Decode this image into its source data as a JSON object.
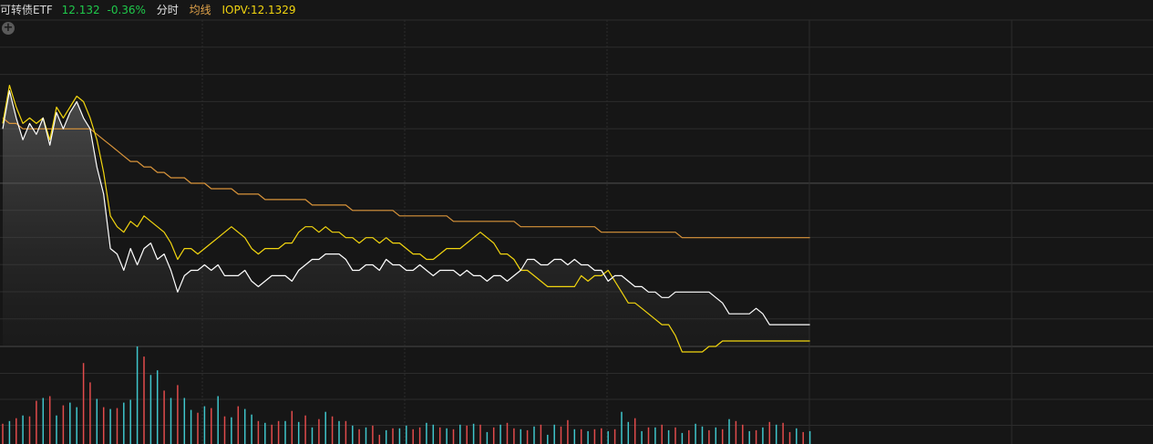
{
  "header": {
    "name": "可转债ETF",
    "price": "12.132",
    "change": "-0.36%",
    "period": "分时",
    "avg_label": "均线",
    "iopv": "IOPV:12.1329"
  },
  "colors": {
    "price_line": "#ffffff",
    "iopv_line": "#f2d50f",
    "avg_line": "#d9943a",
    "vol_up": "#e24b4b",
    "vol_down": "#3fc6cc",
    "grid": "#2c2c2c"
  },
  "chart_data": {
    "type": "line",
    "y_range": [
      12.12,
      12.18
    ],
    "series": [
      {
        "key": "price",
        "values": [
          12.16,
          12.167,
          12.162,
          12.158,
          12.161,
          12.159,
          12.162,
          12.157,
          12.163,
          12.16,
          12.163,
          12.165,
          12.162,
          12.16,
          12.153,
          12.148,
          12.138,
          12.137,
          12.134,
          12.138,
          12.135,
          12.138,
          12.139,
          12.136,
          12.137,
          12.134,
          12.13,
          12.133,
          12.134,
          12.134,
          12.135,
          12.134,
          12.135,
          12.133,
          12.133,
          12.133,
          12.134,
          12.132,
          12.131,
          12.132,
          12.133,
          12.133,
          12.133,
          12.132,
          12.134,
          12.135,
          12.136,
          12.136,
          12.137,
          12.137,
          12.137,
          12.136,
          12.134,
          12.134,
          12.135,
          12.135,
          12.134,
          12.136,
          12.135,
          12.135,
          12.134,
          12.134,
          12.135,
          12.134,
          12.133,
          12.134,
          12.134,
          12.134,
          12.133,
          12.134,
          12.133,
          12.133,
          12.132,
          12.133,
          12.133,
          12.132,
          12.133,
          12.134,
          12.136,
          12.136,
          12.135,
          12.135,
          12.136,
          12.136,
          12.135,
          12.136,
          12.135,
          12.135,
          12.134,
          12.134,
          12.132,
          12.133,
          12.133,
          12.132,
          12.131,
          12.131,
          12.13,
          12.13,
          12.129,
          12.129,
          12.13,
          12.13,
          12.13,
          12.13,
          12.13,
          12.13,
          12.129,
          12.128,
          12.126,
          12.126,
          12.126,
          12.126,
          12.127,
          12.126,
          12.124,
          12.124,
          12.124,
          12.124,
          12.124,
          12.124,
          12.124
        ]
      },
      {
        "key": "iopv",
        "values": [
          12.161,
          12.168,
          12.164,
          12.161,
          12.162,
          12.161,
          12.162,
          12.158,
          12.164,
          12.162,
          12.164,
          12.166,
          12.165,
          12.162,
          12.158,
          12.152,
          12.144,
          12.142,
          12.141,
          12.143,
          12.142,
          12.144,
          12.143,
          12.142,
          12.141,
          12.139,
          12.136,
          12.138,
          12.138,
          12.137,
          12.138,
          12.139,
          12.14,
          12.141,
          12.142,
          12.141,
          12.14,
          12.138,
          12.137,
          12.138,
          12.138,
          12.138,
          12.139,
          12.139,
          12.141,
          12.142,
          12.142,
          12.141,
          12.142,
          12.141,
          12.141,
          12.14,
          12.14,
          12.139,
          12.14,
          12.14,
          12.139,
          12.14,
          12.139,
          12.139,
          12.138,
          12.137,
          12.137,
          12.136,
          12.136,
          12.137,
          12.138,
          12.138,
          12.138,
          12.139,
          12.14,
          12.141,
          12.14,
          12.139,
          12.137,
          12.137,
          12.136,
          12.134,
          12.134,
          12.133,
          12.132,
          12.131,
          12.131,
          12.131,
          12.131,
          12.131,
          12.133,
          12.132,
          12.133,
          12.133,
          12.134,
          12.132,
          12.13,
          12.128,
          12.128,
          12.127,
          12.126,
          12.125,
          12.124,
          12.124,
          12.122,
          12.119,
          12.119,
          12.119,
          12.119,
          12.12,
          12.12,
          12.121,
          12.121,
          12.121,
          12.121,
          12.121,
          12.121,
          12.121,
          12.121,
          12.121,
          12.121,
          12.121,
          12.121,
          12.121,
          12.121
        ]
      },
      {
        "key": "avg",
        "values": [
          12.162,
          12.161,
          12.161,
          12.16,
          12.16,
          12.16,
          12.16,
          12.16,
          12.16,
          12.16,
          12.16,
          12.16,
          12.16,
          12.16,
          12.159,
          12.158,
          12.157,
          12.156,
          12.155,
          12.154,
          12.154,
          12.153,
          12.153,
          12.152,
          12.152,
          12.151,
          12.151,
          12.151,
          12.15,
          12.15,
          12.15,
          12.149,
          12.149,
          12.149,
          12.149,
          12.148,
          12.148,
          12.148,
          12.148,
          12.147,
          12.147,
          12.147,
          12.147,
          12.147,
          12.147,
          12.147,
          12.146,
          12.146,
          12.146,
          12.146,
          12.146,
          12.146,
          12.145,
          12.145,
          12.145,
          12.145,
          12.145,
          12.145,
          12.145,
          12.144,
          12.144,
          12.144,
          12.144,
          12.144,
          12.144,
          12.144,
          12.144,
          12.143,
          12.143,
          12.143,
          12.143,
          12.143,
          12.143,
          12.143,
          12.143,
          12.143,
          12.143,
          12.142,
          12.142,
          12.142,
          12.142,
          12.142,
          12.142,
          12.142,
          12.142,
          12.142,
          12.142,
          12.142,
          12.142,
          12.141,
          12.141,
          12.141,
          12.141,
          12.141,
          12.141,
          12.141,
          12.141,
          12.141,
          12.141,
          12.141,
          12.141,
          12.14,
          12.14,
          12.14,
          12.14,
          12.14,
          12.14,
          12.14,
          12.14,
          12.14,
          12.14,
          12.14,
          12.14,
          12.14,
          12.14,
          12.14,
          12.14,
          12.14,
          12.14,
          12.14,
          12.14
        ]
      }
    ],
    "volume": {
      "y_range": [
        0,
        105
      ],
      "values": [
        22,
        25,
        28,
        31,
        30,
        47,
        50,
        52,
        31,
        42,
        45,
        40,
        88,
        67,
        49,
        40,
        38,
        39,
        45,
        48,
        106,
        95,
        75,
        80,
        58,
        50,
        64,
        50,
        37,
        34,
        41,
        39,
        52,
        30,
        29,
        41,
        38,
        32,
        25,
        23,
        21,
        25,
        25,
        36,
        24,
        31,
        18,
        27,
        35,
        30,
        25,
        25,
        20,
        16,
        18,
        20,
        10,
        15,
        17,
        17,
        20,
        16,
        18,
        23,
        21,
        18,
        17,
        16,
        21,
        20,
        22,
        21,
        13,
        18,
        21,
        23,
        17,
        16,
        15,
        19,
        21,
        10,
        21,
        19,
        26,
        16,
        16,
        14,
        16,
        17,
        14,
        16,
        35,
        24,
        28,
        14,
        18,
        18,
        21,
        15,
        18,
        12,
        15,
        22,
        19,
        15,
        18,
        16,
        27,
        25,
        21,
        14,
        15,
        18,
        24,
        21,
        23,
        13,
        17,
        13,
        14
      ],
      "directions": [
        "u",
        "d",
        "u",
        "d",
        "u",
        "u",
        "d",
        "u",
        "d",
        "u",
        "d",
        "d",
        "u",
        "u",
        "d",
        "u",
        "d",
        "u",
        "d",
        "d",
        "d",
        "u",
        "d",
        "d",
        "u",
        "d",
        "u",
        "d",
        "d",
        "u",
        "d",
        "u",
        "d",
        "u",
        "d",
        "u",
        "d",
        "d",
        "u",
        "d",
        "u",
        "u",
        "d",
        "u",
        "d",
        "u",
        "d",
        "u",
        "d",
        "u",
        "d",
        "u",
        "d",
        "u",
        "d",
        "u",
        "u",
        "d",
        "u",
        "d",
        "d",
        "u",
        "u",
        "d",
        "d",
        "u",
        "d",
        "u",
        "d",
        "u",
        "d",
        "u",
        "d",
        "u",
        "d",
        "u",
        "u",
        "d",
        "u",
        "d",
        "u",
        "d",
        "d",
        "u",
        "u",
        "d",
        "u",
        "d",
        "u",
        "u",
        "d",
        "u",
        "d",
        "d",
        "u",
        "d",
        "u",
        "d",
        "u",
        "d",
        "u",
        "d",
        "u",
        "d",
        "d",
        "u",
        "d",
        "u",
        "d",
        "u",
        "u",
        "d",
        "u",
        "d",
        "u",
        "d",
        "u",
        "u",
        "d",
        "u",
        "d"
      ]
    }
  }
}
